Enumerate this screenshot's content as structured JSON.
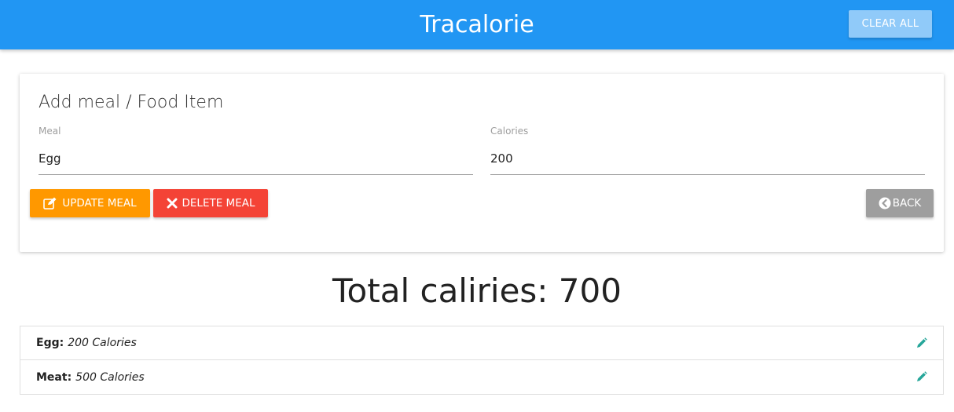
{
  "navbar": {
    "brand": "Tracalorie",
    "clear_all_label": "CLEAR ALL"
  },
  "form": {
    "title": "Add meal / Food Item",
    "meal_label": "Meal",
    "meal_value": "Egg",
    "calories_label": "Calories",
    "calories_value": "200",
    "update_label": "UPDATE MEAL",
    "delete_label": "DELETE MEAL",
    "back_label": "BACK"
  },
  "total": {
    "text": "Total caliries: 700"
  },
  "items": [
    {
      "name": "Egg:",
      "calories": "200 Calories"
    },
    {
      "name": "Meat:",
      "calories": "500 Calories"
    }
  ],
  "colors": {
    "primary": "#2196f3",
    "update": "#ff9800",
    "delete": "#f44336",
    "back": "#9e9e9e",
    "edit_icon": "#26a69a"
  },
  "icons": {
    "update": "edit-icon",
    "delete": "close-icon",
    "back": "chevron-left-circle-icon",
    "item_edit": "pencil-icon"
  }
}
